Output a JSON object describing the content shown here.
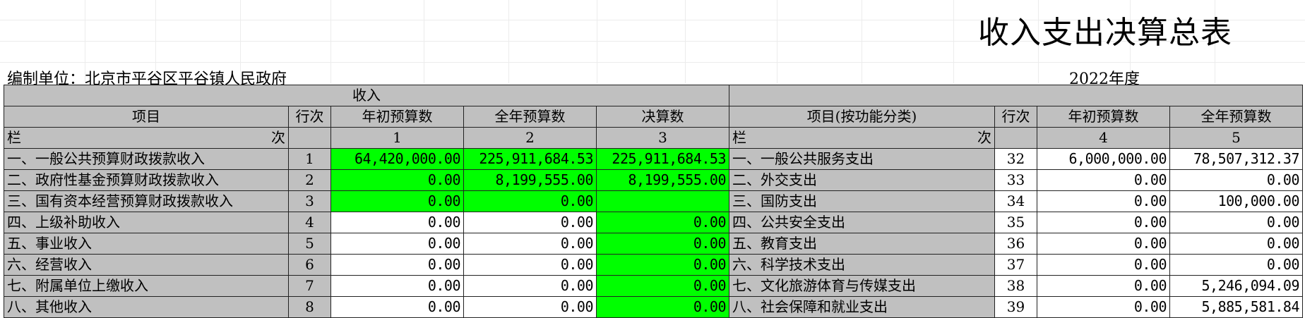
{
  "title": "收入支出决算总表",
  "unit_label": "编制单位：北京市平谷区平谷镇人民政府",
  "year_label": "2022年度",
  "income_section": "收入",
  "income_headers": {
    "item": "项目",
    "row_no": "行次",
    "initial_budget": "年初预算数",
    "annual_budget": "全年预算数",
    "final_amount": "决算数"
  },
  "expense_headers": {
    "item": "项目(按功能分类)",
    "row_no": "行次",
    "initial_budget": "年初预算数",
    "annual_budget": "全年预算数"
  },
  "lan_label": "栏",
  "ci_label": "次",
  "col_numbers": {
    "income_initial": "1",
    "income_annual": "2",
    "income_final": "3",
    "expense_initial": "4",
    "expense_annual": "5"
  },
  "income_rows": [
    {
      "item": "一、一般公共预算财政拨款收入",
      "row_no": "1",
      "initial": "64,420,000.00",
      "annual": "225,911,684.53",
      "final": "225,911,684.53"
    },
    {
      "item": "二、政府性基金预算财政拨款收入",
      "row_no": "2",
      "initial": "0.00",
      "annual": "8,199,555.00",
      "final": "8,199,555.00"
    },
    {
      "item": "三、国有资本经营预算财政拨款收入",
      "row_no": "3",
      "initial": "0.00",
      "annual": "0.00",
      "final": ""
    },
    {
      "item": "四、上级补助收入",
      "row_no": "4",
      "initial": "0.00",
      "annual": "0.00",
      "final": "0.00"
    },
    {
      "item": "五、事业收入",
      "row_no": "5",
      "initial": "0.00",
      "annual": "0.00",
      "final": "0.00"
    },
    {
      "item": "六、经营收入",
      "row_no": "6",
      "initial": "0.00",
      "annual": "0.00",
      "final": "0.00"
    },
    {
      "item": "七、附属单位上缴收入",
      "row_no": "7",
      "initial": "0.00",
      "annual": "0.00",
      "final": "0.00"
    },
    {
      "item": "八、其他收入",
      "row_no": "8",
      "initial": "0.00",
      "annual": "0.00",
      "final": "0.00"
    }
  ],
  "expense_rows": [
    {
      "item": "一、一般公共服务支出",
      "row_no": "32",
      "initial": "6,000,000.00",
      "annual": "78,507,312.37"
    },
    {
      "item": "二、外交支出",
      "row_no": "33",
      "initial": "0.00",
      "annual": "0.00"
    },
    {
      "item": "三、国防支出",
      "row_no": "34",
      "initial": "0.00",
      "annual": "100,000.00"
    },
    {
      "item": "四、公共安全支出",
      "row_no": "35",
      "initial": "0.00",
      "annual": "0.00"
    },
    {
      "item": "五、教育支出",
      "row_no": "36",
      "initial": "0.00",
      "annual": "0.00"
    },
    {
      "item": "六、科学技术支出",
      "row_no": "37",
      "initial": "0.00",
      "annual": "0.00"
    },
    {
      "item": "七、文化旅游体育与传媒支出",
      "row_no": "38",
      "initial": "0.00",
      "annual": "5,246,094.09"
    },
    {
      "item": "八、社会保障和就业支出",
      "row_no": "39",
      "initial": "0.00",
      "annual": "5,885,581.84"
    }
  ],
  "colors": {
    "header_gray": "#c0c0c0",
    "highlight_green": "#00ff00",
    "border": "#222222"
  }
}
